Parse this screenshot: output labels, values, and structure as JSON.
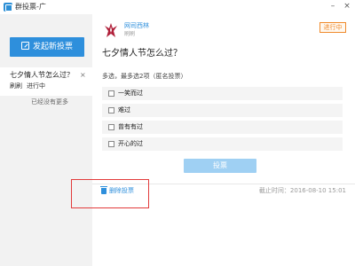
{
  "window": {
    "title": "群投票-广",
    "controls": {
      "minimize": "–",
      "close": "×"
    }
  },
  "sidebar": {
    "create_label": "发起新投票",
    "items": [
      {
        "title": "七夕情人节怎么过？",
        "close": "×",
        "author": "刷刷",
        "status": "进行中"
      }
    ],
    "no_more": "已经没有更多"
  },
  "vote": {
    "publisher": "网司西林",
    "publisher_sub": "刷刷",
    "status": "进行中",
    "question": "七夕情人节怎么过？",
    "hint": "多选，最多选2项（匿名投票）",
    "options": [
      "一笑而过",
      "难过",
      "曾有有过",
      "开心的过"
    ],
    "vote_label": "投票",
    "delete_label": "删除投票",
    "deadline": "截止时间：2016-08-10 15:01"
  },
  "colors": {
    "accent": "#2e8fdc",
    "status": "#f08a2b",
    "highlight": "#e23b3b"
  }
}
